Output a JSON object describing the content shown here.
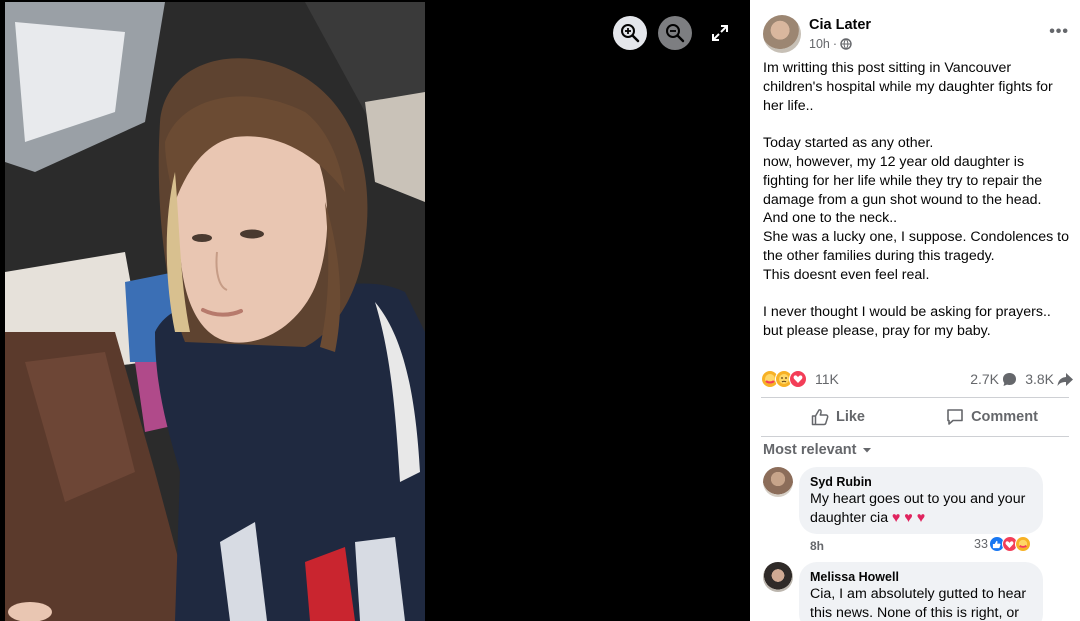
{
  "post": {
    "author": "Cia Later",
    "time": "10h",
    "separator": "·",
    "privacy_icon": "globe-icon",
    "more_label": "•••",
    "body": [
      "Im writting this post sitting in Vancouver children's hospital while my daughter fights for her life..",
      "",
      "Today started as any other.",
      "now, however, my 12 year old daughter is fighting for her life while they try to repair the damage from a gun shot wound to the head.",
      "And one to the neck..",
      "She was a lucky one, I suppose. Condolences to the other families during this tragedy.",
      "This doesnt even feel real.",
      "",
      "I never thought I would be asking for prayers.. but please please, pray for my baby."
    ]
  },
  "stats": {
    "reactions_count": "11K",
    "comments_count": "2.7K",
    "shares_count": "3.8K",
    "reaction_icons": [
      "care-icon",
      "sad-icon",
      "love-icon"
    ]
  },
  "actions": {
    "like_label": "Like",
    "comment_label": "Comment"
  },
  "sort_label": "Most relevant",
  "comments": [
    {
      "name": "Syd Rubin",
      "text_line1": "My heart goes out to you and your",
      "text_line2": "daughter cia ♥ ♥ ♥",
      "time": "8h",
      "reactions_count": "33"
    },
    {
      "name": "Melissa Howell",
      "text_line1": "Cia, I am absolutely gutted to hear",
      "text_line2": "this news. None of this is right, or"
    }
  ],
  "colors": {
    "panel_bg": "#ffffff",
    "viewer_bg": "#000000",
    "secondary_text": "#65676b",
    "like_blue": "#1877f2",
    "love_red": "#f33e58",
    "care_yellow": "#f7b125"
  }
}
